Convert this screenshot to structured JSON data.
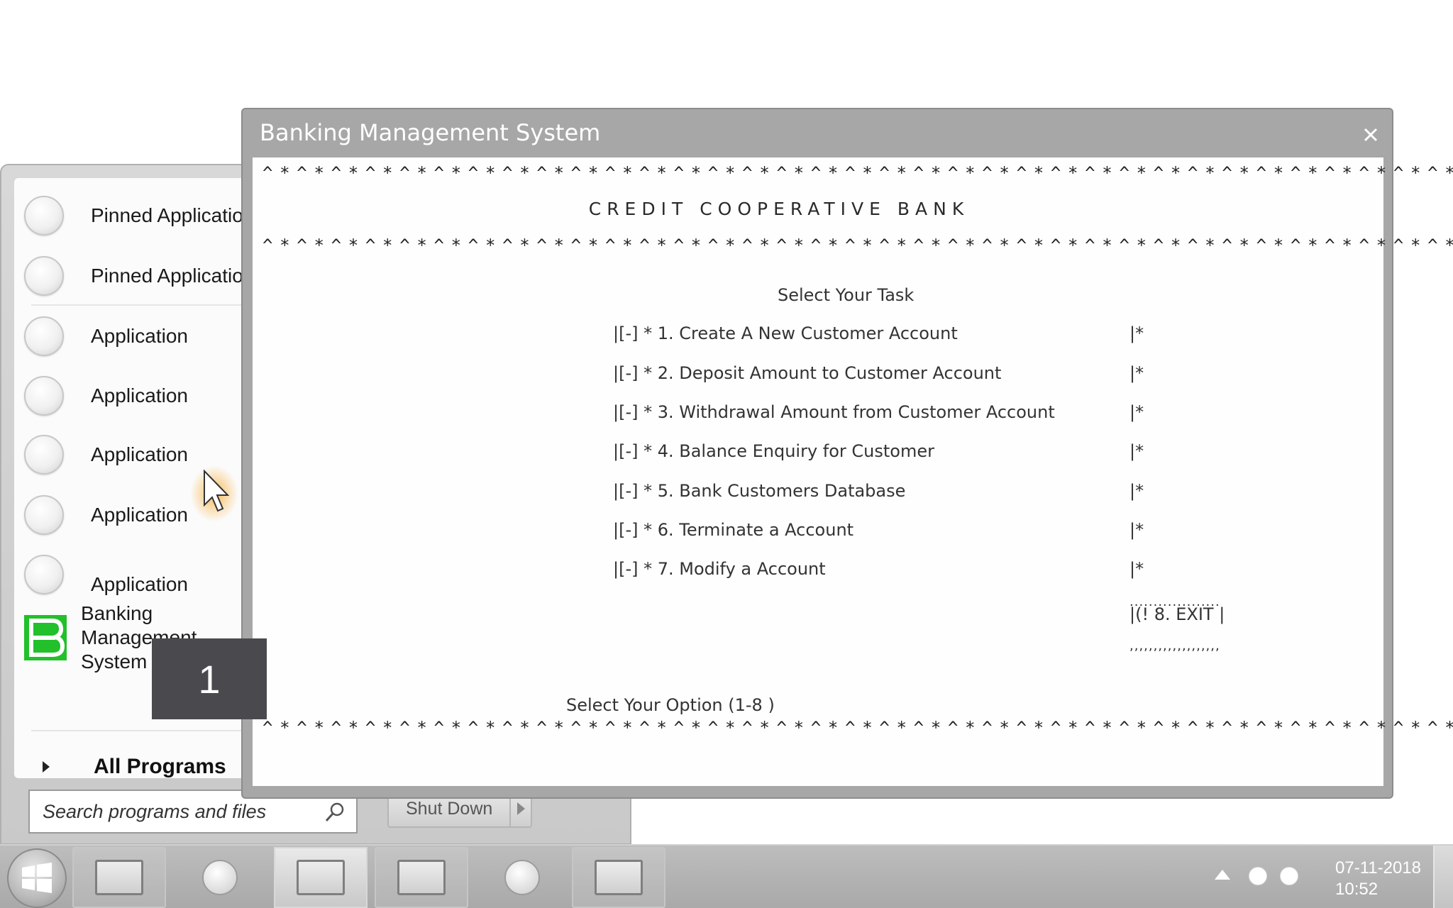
{
  "console": {
    "title": "Banking Management System",
    "border_line": "^*^*^*^*^*^*^*^*^*^*^*^*^*^*^*^*^*^*^*^*^*^*^*^*^*^*^*^*^*^*^*^*^*^*^*^*^*^*^*^*^*^*^*^*^*^*^*^*^*^*^*^*^*^*^*^",
    "bank_name": "CREDIT COOPERATIVE BANK",
    "task_heading": "Select Your Task",
    "options": [
      {
        "label": "|[-] * 1. Create A New Customer Account",
        "end": "|*"
      },
      {
        "label": "|[-] * 2. Deposit Amount to Customer Account",
        "end": "|*"
      },
      {
        "label": "|[-] * 3. Withdrawal Amount from Customer Account",
        "end": "|*"
      },
      {
        "label": "|[-] * 4. Balance Enquiry for Customer",
        "end": "|*"
      },
      {
        "label": "|[-] * 5. Bank Customers Database",
        "end": "|*"
      },
      {
        "label": "|[-] * 6. Terminate a Account",
        "end": "|*"
      },
      {
        "label": "|[-] * 7. Modify a Account",
        "end": "|*"
      }
    ],
    "exit_dots_top": "...................",
    "exit_label": "|(! 8. EXIT |",
    "exit_dots_bottom": ",,,,,,,,,,,,,,,,,,,",
    "prompt": "Select Your Option (1-8 )"
  },
  "start_menu": {
    "items": [
      {
        "label": "Pinned Application",
        "icon": "app-circle-icon"
      },
      {
        "label": "Pinned Application",
        "icon": "app-circle-icon"
      },
      {
        "label": "Application",
        "icon": "app-circle-icon"
      },
      {
        "label": "Application",
        "icon": "app-circle-icon"
      },
      {
        "label": "Application",
        "icon": "app-circle-icon"
      },
      {
        "label": "Application",
        "icon": "app-circle-icon"
      },
      {
        "label": "Application",
        "icon": "app-circle-icon"
      }
    ],
    "bms_item": {
      "label": "Banking Management System",
      "icon": "bms-logo-icon",
      "icon_color": "#22c02a"
    },
    "all_programs": "All Programs",
    "search_placeholder": "Search programs and files",
    "shutdown_label": "Shut Down"
  },
  "key_overlay": "1",
  "taskbar": {
    "buttons": [
      {
        "icon": "window-square-icon"
      },
      {
        "icon": "app-circle-icon"
      },
      {
        "icon": "window-square-icon",
        "active": true
      },
      {
        "icon": "window-square-icon"
      },
      {
        "icon": "app-circle-icon"
      },
      {
        "icon": "window-square-icon"
      }
    ],
    "clock_date": "07-11-2018",
    "clock_time": "10:52"
  },
  "colors": {
    "accent_green": "#22c02a",
    "console_frame": "#a7a7a7",
    "key_overlay": "#4a4a4e"
  }
}
